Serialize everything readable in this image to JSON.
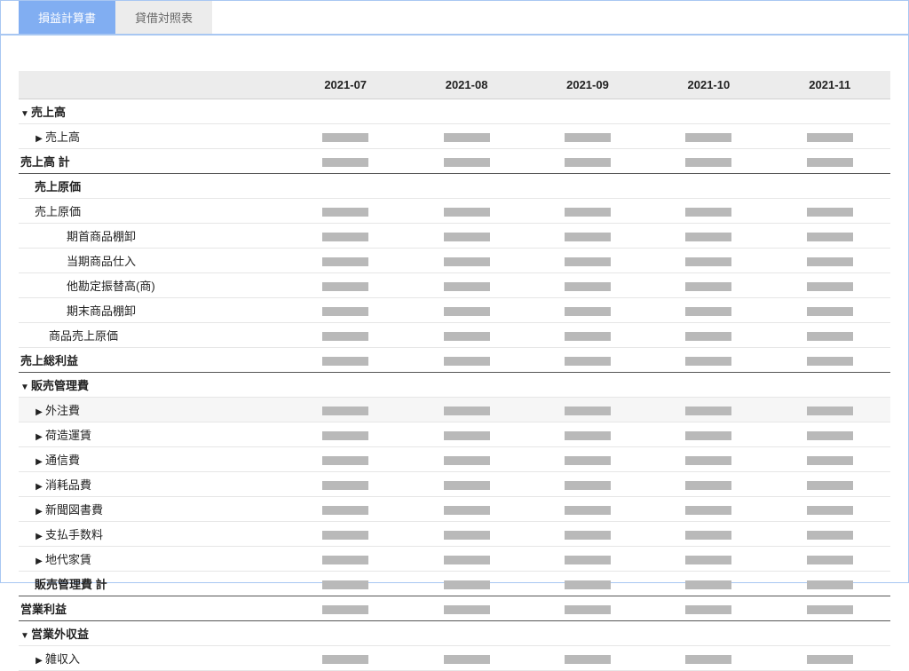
{
  "tabs": {
    "active": "損益計算書",
    "inactive": "貸借対照表"
  },
  "periods": [
    "2021-07",
    "2021-08",
    "2021-09",
    "2021-10",
    "2021-11"
  ],
  "rows": [
    {
      "label": "売上高",
      "indent": 0,
      "toggle": "down",
      "bold": true,
      "hasVals": false
    },
    {
      "label": "売上高",
      "indent": 1,
      "toggle": "right",
      "bold": false,
      "hasVals": true
    },
    {
      "label": "売上高 計",
      "indent": 0,
      "toggle": "",
      "bold": true,
      "hasVals": true,
      "total": true
    },
    {
      "label": "売上原価",
      "indent": 1,
      "toggle": "",
      "bold": true,
      "hasVals": false
    },
    {
      "label": "売上原価",
      "indent": 1,
      "toggle": "",
      "bold": false,
      "hasVals": true
    },
    {
      "label": "期首商品棚卸",
      "indent": 3,
      "toggle": "",
      "bold": false,
      "hasVals": true
    },
    {
      "label": "当期商品仕入",
      "indent": 3,
      "toggle": "",
      "bold": false,
      "hasVals": true
    },
    {
      "label": "他勘定振替高(商)",
      "indent": 3,
      "toggle": "",
      "bold": false,
      "hasVals": true
    },
    {
      "label": "期末商品棚卸",
      "indent": 3,
      "toggle": "",
      "bold": false,
      "hasVals": true
    },
    {
      "label": "商品売上原価",
      "indent": 2,
      "toggle": "",
      "bold": false,
      "hasVals": true
    },
    {
      "label": "売上総利益",
      "indent": 0,
      "toggle": "",
      "bold": true,
      "hasVals": true,
      "total": true
    },
    {
      "label": "販売管理費",
      "indent": 0,
      "toggle": "down",
      "bold": true,
      "hasVals": false
    },
    {
      "label": "外注費",
      "indent": 1,
      "toggle": "right",
      "bold": false,
      "hasVals": true,
      "highlight": true
    },
    {
      "label": "荷造運賃",
      "indent": 1,
      "toggle": "right",
      "bold": false,
      "hasVals": true
    },
    {
      "label": "通信費",
      "indent": 1,
      "toggle": "right",
      "bold": false,
      "hasVals": true
    },
    {
      "label": "消耗品費",
      "indent": 1,
      "toggle": "right",
      "bold": false,
      "hasVals": true
    },
    {
      "label": "新聞図書費",
      "indent": 1,
      "toggle": "right",
      "bold": false,
      "hasVals": true
    },
    {
      "label": "支払手数料",
      "indent": 1,
      "toggle": "right",
      "bold": false,
      "hasVals": true
    },
    {
      "label": "地代家賃",
      "indent": 1,
      "toggle": "right",
      "bold": false,
      "hasVals": true
    },
    {
      "label": "販売管理費 計",
      "indent": 1,
      "toggle": "",
      "bold": true,
      "hasVals": true,
      "total": true
    },
    {
      "label": "営業利益",
      "indent": 0,
      "toggle": "",
      "bold": true,
      "hasVals": true,
      "total": true
    },
    {
      "label": "営業外収益",
      "indent": 0,
      "toggle": "down",
      "bold": true,
      "hasVals": false
    },
    {
      "label": "雑収入",
      "indent": 1,
      "toggle": "right",
      "bold": false,
      "hasVals": true
    }
  ]
}
